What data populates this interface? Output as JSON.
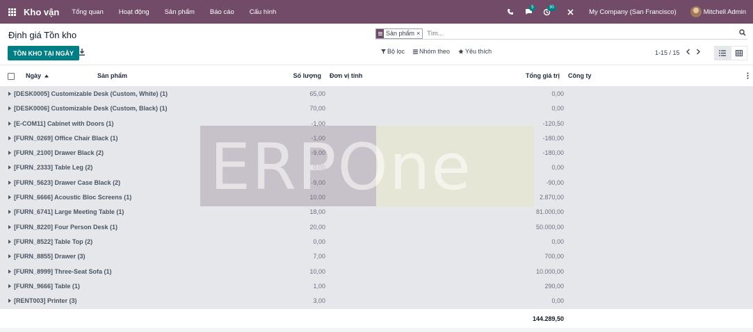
{
  "navbar": {
    "app_name": "Kho vận",
    "menu": [
      "Tổng quan",
      "Hoạt động",
      "Sản phẩm",
      "Báo cáo",
      "Cấu hình"
    ],
    "messages_count": "5",
    "activity_count": "30",
    "company": "My Company (San Francisco)",
    "user": "Mitchell Admin"
  },
  "control": {
    "title": "Định giá Tồn kho",
    "primary_button": "TỒN KHO TẠI NGÀY",
    "search": {
      "facet_label": "Sản phẩm",
      "placeholder": "Tìm..."
    },
    "filters": {
      "filter": "Bộ lọc",
      "group_by": "Nhóm theo",
      "favorites": "Yêu thích"
    },
    "pager": "1-15 / 15"
  },
  "table": {
    "headers": {
      "date": "Ngày",
      "product": "Sản phẩm",
      "quantity": "Số lượng",
      "uom": "Đơn vị tính",
      "total_value": "Tổng giá trị",
      "company": "Công ty"
    },
    "rows": [
      {
        "name": "[DESK0005] Customizable Desk (Custom, White) (1)",
        "qty": "65,00",
        "total": "0,00"
      },
      {
        "name": "[DESK0006] Customizable Desk (Custom, Black) (1)",
        "qty": "70,00",
        "total": "0,00"
      },
      {
        "name": "[E-COM11] Cabinet with Doors (1)",
        "qty": "-1,00",
        "total": "-120,50"
      },
      {
        "name": "[FURN_0269] Office Chair Black (1)",
        "qty": "-1,00",
        "total": "-180,00"
      },
      {
        "name": "[FURN_2100] Drawer Black (2)",
        "qty": "-9,00",
        "total": "-180,00"
      },
      {
        "name": "[FURN_2333] Table Leg (2)",
        "qty": "0,00",
        "total": "0,00"
      },
      {
        "name": "[FURN_5623] Drawer Case Black (2)",
        "qty": "-9,00",
        "total": "-90,00"
      },
      {
        "name": "[FURN_6666] Acoustic Bloc Screens (1)",
        "qty": "10,00",
        "total": "2.870,00"
      },
      {
        "name": "[FURN_6741] Large Meeting Table (1)",
        "qty": "18,00",
        "total": "81.000,00"
      },
      {
        "name": "[FURN_8220] Four Person Desk (1)",
        "qty": "20,00",
        "total": "50.000,00"
      },
      {
        "name": "[FURN_8522] Table Top (2)",
        "qty": "0,00",
        "total": "0,00"
      },
      {
        "name": "[FURN_8855] Drawer (3)",
        "qty": "7,00",
        "total": "700,00"
      },
      {
        "name": "[FURN_8999] Three-Seat Sofa (1)",
        "qty": "10,00",
        "total": "10.000,00"
      },
      {
        "name": "[FURN_9666] Table (1)",
        "qty": "1,00",
        "total": "290,00"
      },
      {
        "name": "[RENT003] Printer (3)",
        "qty": "3,00",
        "total": "0,00"
      }
    ],
    "grand_total": "144.289,50"
  },
  "watermark": {
    "text": "ERPOne"
  }
}
